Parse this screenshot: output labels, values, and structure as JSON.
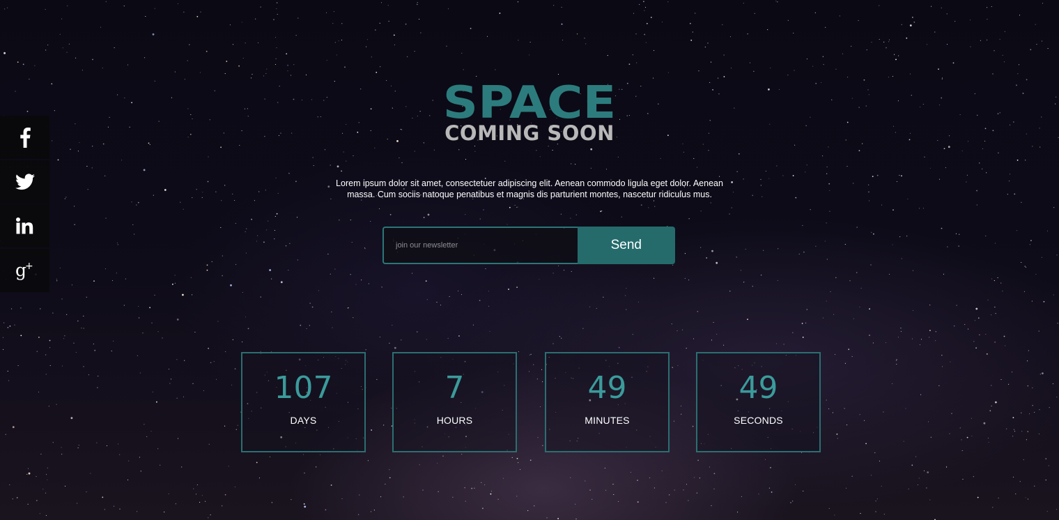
{
  "theme": {
    "accent": "#2c7c7d",
    "accent_text": "#3b9b9b",
    "background": "#0b0a14"
  },
  "social": [
    {
      "name": "facebook",
      "icon": "facebook-icon"
    },
    {
      "name": "twitter",
      "icon": "twitter-icon"
    },
    {
      "name": "linkedin",
      "icon": "linkedin-icon",
      "label": "in"
    },
    {
      "name": "google-plus",
      "icon": "google-plus-icon",
      "label": "g+"
    }
  ],
  "hero": {
    "title": "SPACE",
    "subtitle": "COMING SOON",
    "description": "Lorem ipsum dolor sit amet, consectetuer adipiscing elit. Aenean commodo ligula eget dolor. Aenean massa. Cum sociis natoque penatibus et magnis dis parturient montes, nascetur ridiculus mus."
  },
  "newsletter": {
    "placeholder": "join our newsletter",
    "value": "",
    "button_label": "Send"
  },
  "countdown": [
    {
      "value": "107",
      "label": "DAYS"
    },
    {
      "value": "7",
      "label": "HOURS"
    },
    {
      "value": "49",
      "label": "MINUTES"
    },
    {
      "value": "49",
      "label": "SECONDS"
    }
  ]
}
